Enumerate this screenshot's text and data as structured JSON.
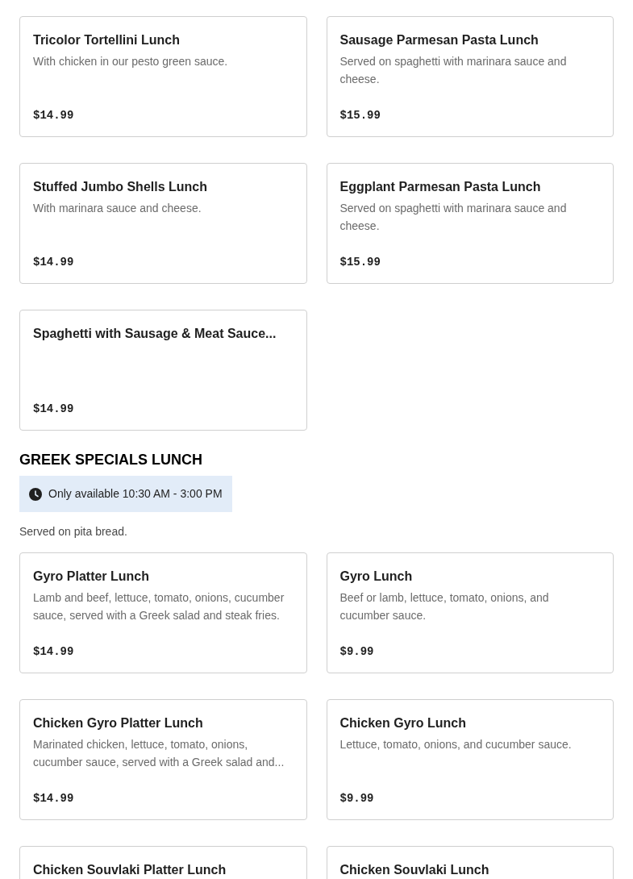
{
  "sections": [
    {
      "items": [
        {
          "name": "Tricolor Tortellini Lunch",
          "description": "With chicken in our pesto green sauce.",
          "price": "$14.99"
        },
        {
          "name": "Sausage Parmesan Pasta Lunch",
          "description": "Served on spaghetti with marinara sauce and cheese.",
          "price": "$15.99"
        },
        {
          "name": "Stuffed Jumbo Shells Lunch",
          "description": "With marinara sauce and cheese.",
          "price": "$14.99"
        },
        {
          "name": "Eggplant Parmesan Pasta Lunch",
          "description": "Served on spaghetti with marinara sauce and cheese.",
          "price": "$15.99"
        },
        {
          "name": "Spaghetti with Sausage & Meat Sauce...",
          "price": "$14.99"
        }
      ]
    },
    {
      "title": "GREEK SPECIALS LUNCH",
      "availability": "Only available 10:30 AM - 3:00 PM",
      "note": "Served on pita bread.",
      "items": [
        {
          "name": "Gyro Platter Lunch",
          "description": "Lamb and beef, lettuce, tomato, onions, cucumber sauce, served with a Greek salad and steak fries.",
          "price": "$14.99"
        },
        {
          "name": "Gyro Lunch",
          "description": "Beef or lamb, lettuce, tomato, onions, and cucumber sauce.",
          "price": "$9.99"
        },
        {
          "name": "Chicken Gyro Platter Lunch",
          "description": "Marinated chicken, lettuce, tomato, onions, cucumber sauce, served with a Greek salad and...",
          "price": "$14.99"
        },
        {
          "name": "Chicken Gyro Lunch",
          "description": "Lettuce, tomato, onions, and cucumber sauce.",
          "price": "$9.99"
        },
        {
          "name": "Chicken Souvlaki Platter Lunch"
        },
        {
          "name": "Chicken Souvlaki Lunch"
        }
      ]
    }
  ]
}
